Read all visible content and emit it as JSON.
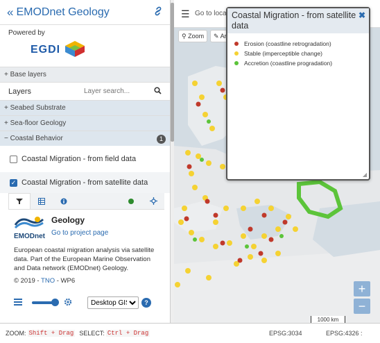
{
  "sidebar": {
    "title": "EMODnet Geology",
    "back_icon": "«",
    "powered_by": "Powered by",
    "egdi_logo": "EGDI",
    "base_layers": "+ Base layers",
    "layers_label": "Layers",
    "layer_search_placeholder": "Layer search...",
    "groups": [
      {
        "label": "+ Seabed Substrate"
      },
      {
        "label": "+ Sea-floor Geology"
      },
      {
        "label": "− Coastal Behavior",
        "badge": "1"
      }
    ],
    "layer_items": [
      {
        "label": "Coastal Migration - from field data",
        "checked": false
      },
      {
        "label": "Coastal Migration - from satellite data",
        "checked": true
      }
    ],
    "panel": {
      "logo_name": "EMODnet",
      "heading": "Geology",
      "project_link": "Go to project page",
      "description": "European coastal migration analysis via satellite data. Part of the European Marine Observation and Data network (EMODnet) Geology.",
      "copyright_prefix": "© 2019 -",
      "copyright_link": "TNO",
      "copyright_suffix": "- WP6",
      "view_select": "Desktop GIS",
      "help": "?"
    }
  },
  "map": {
    "goto_placeholder": "Go to locat",
    "zoom_button": "Zoom",
    "area_button": "Are",
    "zoom_in": "+",
    "zoom_out": "−",
    "scale_label": "1000 km",
    "legend": {
      "title": "Coastal Migration - from satellite data",
      "close": "✖",
      "items": [
        {
          "label": "Erosion (coastline retrogradation)",
          "color": "#c0392b"
        },
        {
          "label": "Stable (imperceptible change)",
          "color": "#f5d233"
        },
        {
          "label": "Accretion (coastline progradation)",
          "color": "#5cc43a"
        }
      ]
    }
  },
  "statusbar": {
    "zoom_label": "ZOOM:",
    "zoom_key": "Shift + Drag",
    "select_label": "SELECT:",
    "select_key": "Ctrl + Drag",
    "epsg1": "EPSG:3034",
    "epsg2": "EPSG:4326 :"
  }
}
